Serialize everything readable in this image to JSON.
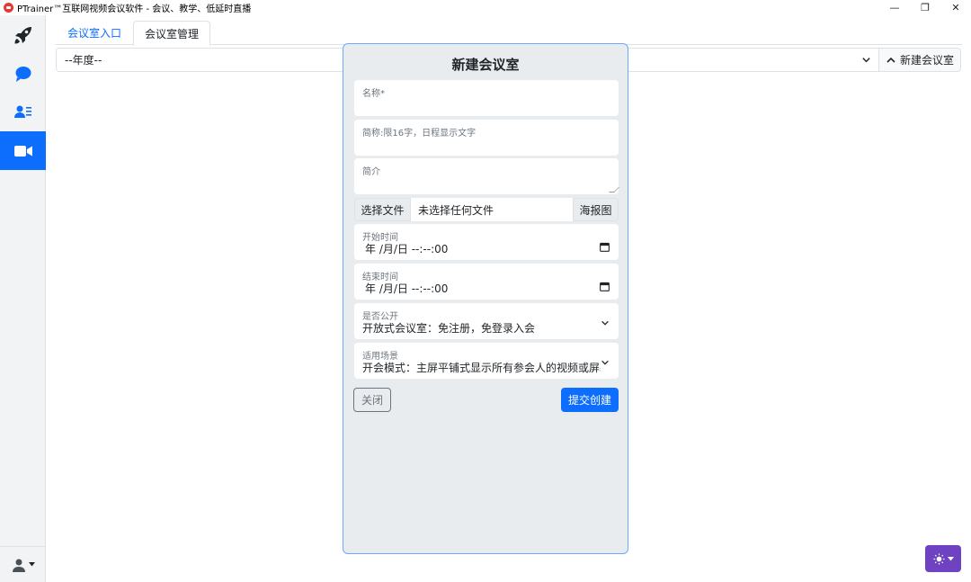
{
  "window": {
    "title": "PTrainer™互联网视频会议软件 - 会议、教学、低延时直播",
    "minimize": "—",
    "restore": "❐",
    "close": "✕"
  },
  "tabs": [
    {
      "label": "会议室入口",
      "active": false
    },
    {
      "label": "会议室管理",
      "active": true
    }
  ],
  "filter": {
    "year_placeholder": "--年度--",
    "new_room_label": "新建会议室"
  },
  "modal": {
    "title": "新建会议室",
    "name_label": "名称*",
    "short_label": "简称:限16字，日程显示文字",
    "desc_label": "简介",
    "file_button": "选择文件",
    "file_status": "未选择任何文件",
    "file_suffix": "海报图",
    "start_label": "开始时间",
    "start_value": "年 /月/日 --:--:00",
    "end_label": "结束时间",
    "end_value": "年 /月/日 --:--:00",
    "public_label": "是否公开",
    "public_value": "开放式会议室：免注册，免登录入会",
    "scene_label": "适用场景",
    "scene_value": "开会模式：主屏平铺式显示所有参会人的视频或屏幕",
    "close_button": "关闭",
    "submit_button": "提交创建"
  },
  "colors": {
    "primary": "#0d6efd",
    "theme_button": "#6f42c1",
    "sidebar_bg": "#f1f3f5",
    "modal_bg": "#e9ecef"
  },
  "icons": {
    "sidebar": [
      "rocket-icon",
      "chat-icon",
      "contacts-icon",
      "video-icon"
    ],
    "user": "user-icon"
  }
}
